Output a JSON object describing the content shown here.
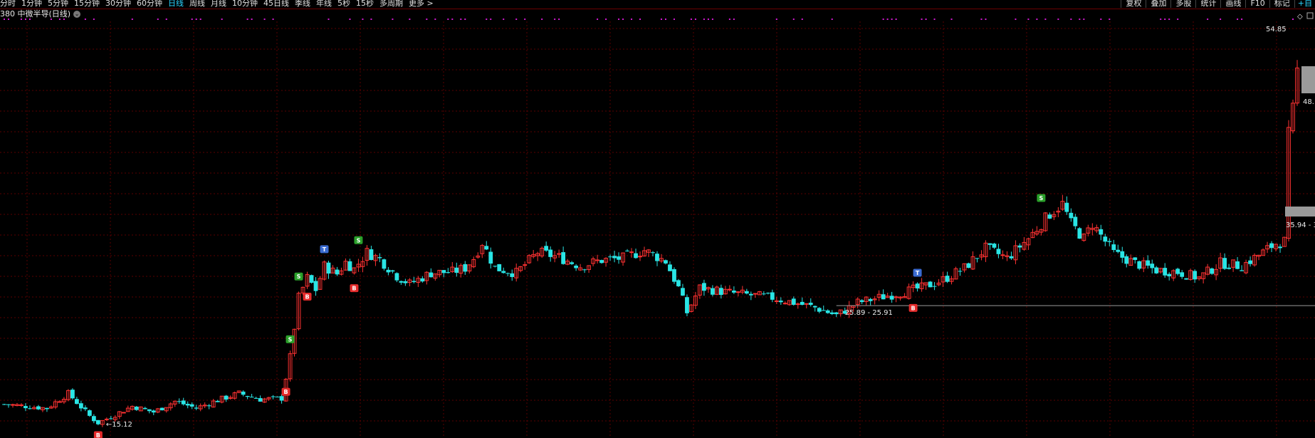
{
  "toolbar": {
    "periods": [
      "分时",
      "1分钟",
      "5分钟",
      "15分钟",
      "30分钟",
      "60分钟",
      "日线",
      "周线",
      "月线",
      "10分钟",
      "45日线",
      "季线",
      "年线",
      "5秒",
      "15秒",
      "多周期",
      "更多 >"
    ],
    "active_period": "日线",
    "right_buttons": [
      "复权",
      "叠加",
      "多股",
      "统计",
      "画线",
      "F10",
      "标记"
    ],
    "right_icon": "+自"
  },
  "stock": {
    "title": "380 中微半导(日线)",
    "dropdown_icon": "chevron-down-icon"
  },
  "annotations": {
    "high_price": "54.85",
    "right_label_upper": "48.",
    "right_label_lower": "35.94 - 3",
    "range_label": "25.89 - 25.91",
    "low_label": "←15.12"
  },
  "colors": {
    "background": "#000000",
    "grid": "#5a0000",
    "up": "#ff3232",
    "down": "#29e5e5",
    "signal_dots": "#d21ad2",
    "buy_marker": "#e52b2b",
    "sell_marker": "#2aa02a",
    "t_marker": "#3a6ad0",
    "active_tab": "#2ad4ff"
  },
  "markers": [
    {
      "type": "B",
      "date_index": 22
    },
    {
      "type": "B",
      "date_index": 66
    },
    {
      "type": "S",
      "date_index": 67
    },
    {
      "type": "S",
      "date_index": 69
    },
    {
      "type": "B",
      "date_index": 71
    },
    {
      "type": "T",
      "date_index": 75
    },
    {
      "type": "B",
      "date_index": 82
    },
    {
      "type": "S",
      "date_index": 83
    },
    {
      "type": "T",
      "date_index": 214
    },
    {
      "type": "B",
      "date_index": 213
    },
    {
      "type": "S",
      "date_index": 243
    }
  ],
  "chart_data": {
    "type": "candlestick",
    "ylim": [
      14,
      56
    ],
    "high": 54.85,
    "low": 15.12,
    "grid": true,
    "anchors": [
      [
        0,
        17.2
      ],
      [
        10,
        16.8
      ],
      [
        15,
        18.3
      ],
      [
        20,
        16.0
      ],
      [
        22,
        15.3
      ],
      [
        30,
        17.0
      ],
      [
        35,
        16.4
      ],
      [
        40,
        17.5
      ],
      [
        45,
        16.8
      ],
      [
        50,
        17.6
      ],
      [
        55,
        18.3
      ],
      [
        60,
        17.7
      ],
      [
        65,
        17.8
      ],
      [
        67,
        22.0
      ],
      [
        69,
        28.0
      ],
      [
        71,
        30.0
      ],
      [
        73,
        28.8
      ],
      [
        75,
        31.2
      ],
      [
        78,
        30.4
      ],
      [
        80,
        31.6
      ],
      [
        82,
        30.9
      ],
      [
        85,
        32.6
      ],
      [
        88,
        31.9
      ],
      [
        92,
        30.2
      ],
      [
        95,
        29.4
      ],
      [
        100,
        30.5
      ],
      [
        105,
        30.6
      ],
      [
        108,
        31.0
      ],
      [
        110,
        32.0
      ],
      [
        112,
        33.6
      ],
      [
        115,
        31.0
      ],
      [
        120,
        30.5
      ],
      [
        125,
        32.6
      ],
      [
        130,
        32.1
      ],
      [
        135,
        31.2
      ],
      [
        140,
        31.8
      ],
      [
        145,
        32.0
      ],
      [
        150,
        32.8
      ],
      [
        155,
        31.7
      ],
      [
        158,
        29.0
      ],
      [
        160,
        26.5
      ],
      [
        163,
        29.0
      ],
      [
        170,
        28.5
      ],
      [
        180,
        28.0
      ],
      [
        190,
        27.0
      ],
      [
        195,
        26.2
      ],
      [
        200,
        27.5
      ],
      [
        210,
        28.5
      ],
      [
        215,
        29.0
      ],
      [
        220,
        29.8
      ],
      [
        225,
        31.0
      ],
      [
        230,
        33.0
      ],
      [
        235,
        32.0
      ],
      [
        240,
        34.0
      ],
      [
        245,
        36.5
      ],
      [
        248,
        37.5
      ],
      [
        250,
        35.5
      ],
      [
        253,
        34.0
      ],
      [
        255,
        35.5
      ],
      [
        260,
        32.5
      ],
      [
        265,
        31.5
      ],
      [
        270,
        30.8
      ],
      [
        275,
        30.6
      ],
      [
        280,
        30.0
      ],
      [
        285,
        31.5
      ],
      [
        290,
        31.2
      ],
      [
        295,
        32.6
      ],
      [
        298,
        33.5
      ],
      [
        300,
        33.7
      ],
      [
        301,
        44.5
      ],
      [
        302,
        47.0
      ],
      [
        303,
        51.0
      ]
    ]
  }
}
